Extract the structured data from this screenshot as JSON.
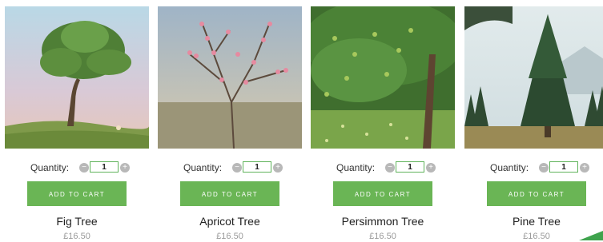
{
  "products": [
    {
      "name": "Fig Tree",
      "price": "£16.50",
      "quantity_label": "Quantity:",
      "quantity": "1",
      "minus": "−",
      "plus": "+",
      "cart_label": "ADD TO CART"
    },
    {
      "name": "Apricot Tree",
      "price": "£16.50",
      "quantity_label": "Quantity:",
      "quantity": "1",
      "minus": "−",
      "plus": "+",
      "cart_label": "ADD TO CART"
    },
    {
      "name": "Persimmon Tree",
      "price": "£16.50",
      "quantity_label": "Quantity:",
      "quantity": "1",
      "minus": "−",
      "plus": "+",
      "cart_label": "ADD TO CART"
    },
    {
      "name": "Pine Tree",
      "price": "£16.50",
      "quantity_label": "Quantity:",
      "quantity": "1",
      "minus": "−",
      "plus": "+",
      "cart_label": "ADD TO CART"
    }
  ],
  "colors": {
    "accent": "#6ab555",
    "price": "#9a9a9a"
  }
}
